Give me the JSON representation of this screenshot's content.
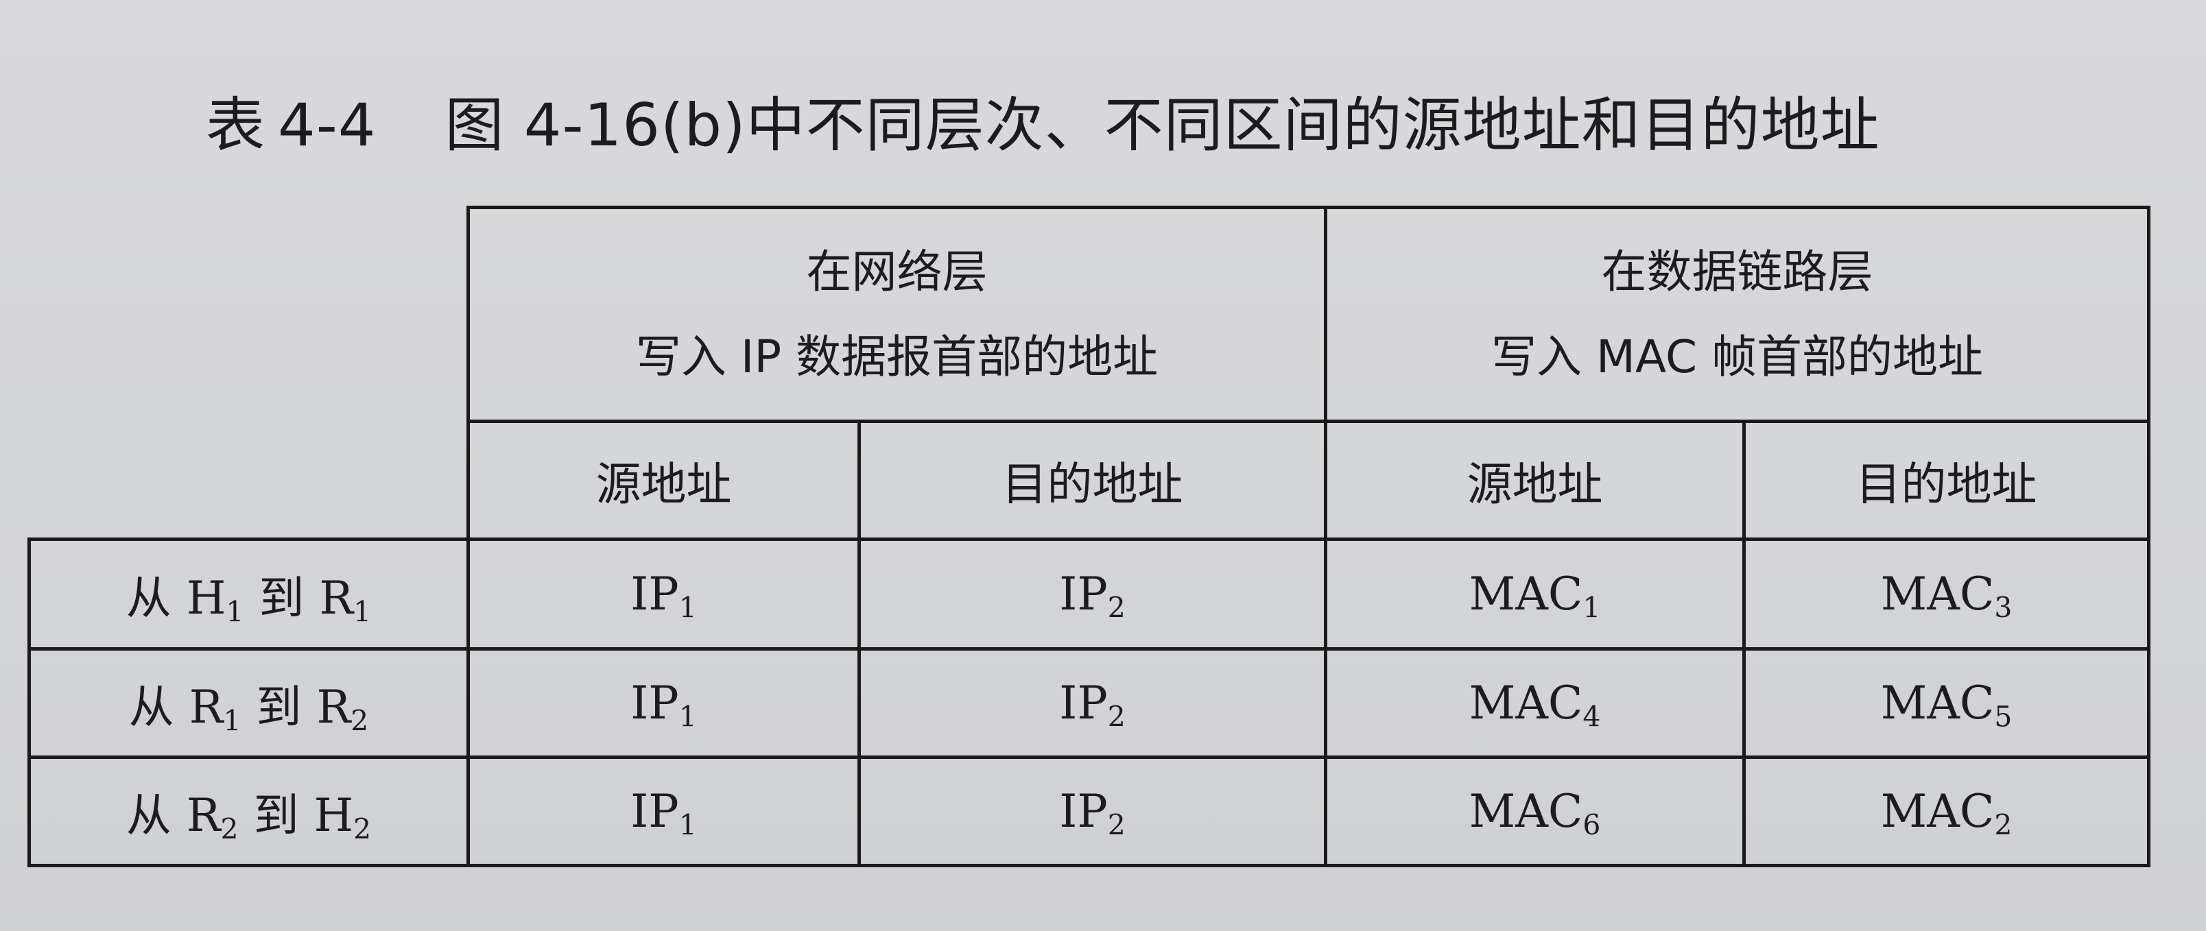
{
  "caption": {
    "label": "表",
    "number": "4-4",
    "text": "图 4-16(b)中不同层次、不同区间的源地址和目的地址"
  },
  "table": {
    "groups": [
      {
        "line1": "在网络层",
        "line2": "写入 IP 数据报首部的地址"
      },
      {
        "line1": "在数据链路层",
        "line2": "写入 MAC 帧首部的地址"
      }
    ],
    "subheaders": [
      "源地址",
      "目的地址",
      "源地址",
      "目的地址"
    ],
    "rows": [
      {
        "from_word": "从",
        "from_base": "H",
        "from_sub": "1",
        "to_word": "到",
        "to_base": "R",
        "to_sub": "1",
        "cells": [
          {
            "base": "IP",
            "sub": "1"
          },
          {
            "base": "IP",
            "sub": "2"
          },
          {
            "base": "MAC",
            "sub": "1"
          },
          {
            "base": "MAC",
            "sub": "3"
          }
        ]
      },
      {
        "from_word": "从",
        "from_base": "R",
        "from_sub": "1",
        "to_word": "到",
        "to_base": "R",
        "to_sub": "2",
        "cells": [
          {
            "base": "IP",
            "sub": "1"
          },
          {
            "base": "IP",
            "sub": "2"
          },
          {
            "base": "MAC",
            "sub": "4"
          },
          {
            "base": "MAC",
            "sub": "5"
          }
        ]
      },
      {
        "from_word": "从",
        "from_base": "R",
        "from_sub": "2",
        "to_word": "到",
        "to_base": "H",
        "to_sub": "2",
        "cells": [
          {
            "base": "IP",
            "sub": "1"
          },
          {
            "base": "IP",
            "sub": "2"
          },
          {
            "base": "MAC",
            "sub": "6"
          },
          {
            "base": "MAC",
            "sub": "2"
          }
        ]
      }
    ]
  }
}
